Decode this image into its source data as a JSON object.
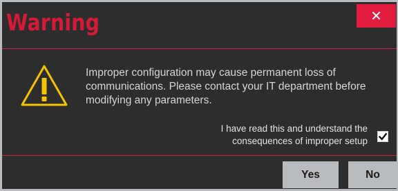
{
  "dialog": {
    "title": "Warning",
    "close_glyph": "✕",
    "icon": "warning-triangle-icon",
    "message": "Improper configuration may cause permanent loss of communications. Please contact your IT department before modifying any parameters.",
    "confirm_label": "I have read this and understand the consequences of improper setup",
    "confirm_checked": true,
    "buttons": {
      "yes": "Yes",
      "no": "No"
    }
  },
  "colors": {
    "accent": "#e21c3e",
    "title_text": "#d51a38",
    "icon_yellow": "#f5c400",
    "background": "#2d2d2d",
    "button_bg": "#b9bcbf"
  }
}
